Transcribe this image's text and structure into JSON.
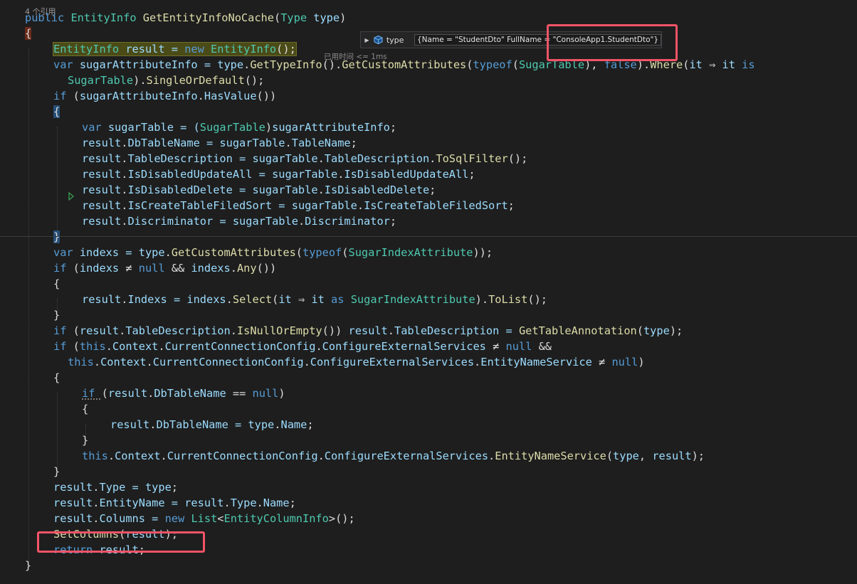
{
  "codelens": "4 个引用",
  "elapsed": "已用时间 <= 1ms",
  "datatip": {
    "expand_icon": "triangle-right-icon",
    "type_icon": "field-icon",
    "name": "type",
    "value": "{Name = \"StudentDto\" FullName = \"ConsoleApp1.StudentDto\"}"
  },
  "colors": {
    "background": "#1e1e1e",
    "keyword": "#569cd6",
    "type": "#4ec9b0",
    "method": "#dcdcaa",
    "variable": "#9cdcfe",
    "text": "#dcdcdc",
    "highlight_box": "#f25467",
    "current_line": "#4b4b18"
  },
  "code_lines": [
    [
      [
        "public ",
        "kw"
      ],
      [
        "EntityInfo ",
        "ty"
      ],
      [
        "GetEntityInfoNoCache",
        "fn"
      ],
      [
        "(",
        "pl"
      ],
      [
        "Type ",
        "ty"
      ],
      [
        "type",
        "vr"
      ],
      [
        ")",
        "pl"
      ]
    ],
    [
      [
        "{",
        "pl"
      ]
    ],
    [
      [
        "EntityInfo ",
        "ty"
      ],
      [
        "result = ",
        "vr"
      ],
      [
        "new ",
        "kw"
      ],
      [
        "EntityInfo",
        "ty"
      ],
      [
        "();",
        "pl"
      ]
    ],
    [
      [
        "var ",
        "kw"
      ],
      [
        "sugarAttributeInfo = ",
        "vr"
      ],
      [
        "type",
        "vr"
      ],
      [
        ".",
        "pl"
      ],
      [
        "GetTypeInfo",
        "fn"
      ],
      [
        "().",
        "pl"
      ],
      [
        "GetCustomAttributes",
        "fn"
      ],
      [
        "(",
        "pl"
      ],
      [
        "typeof",
        "kw"
      ],
      [
        "(",
        "pl"
      ],
      [
        "SugarTable",
        "ty"
      ],
      [
        "), ",
        "pl"
      ],
      [
        "false",
        "kw"
      ],
      [
        ").",
        "pl"
      ],
      [
        "Where",
        "fn"
      ],
      [
        "(",
        "pl"
      ],
      [
        "it ",
        "vr"
      ],
      [
        "⇒ ",
        "pl"
      ],
      [
        "it ",
        "vr"
      ],
      [
        "is",
        "kw"
      ]
    ],
    [
      [
        "SugarTable",
        "ty"
      ],
      [
        ").",
        "pl"
      ],
      [
        "SingleOrDefault",
        "fn"
      ],
      [
        "();",
        "pl"
      ]
    ],
    [
      [
        "if ",
        "kw"
      ],
      [
        "(",
        "pl"
      ],
      [
        "sugarAttributeInfo",
        "vr"
      ],
      [
        ".",
        "pl"
      ],
      [
        "HasValue",
        "vr"
      ],
      [
        "())",
        "pl"
      ]
    ],
    [
      [
        "{",
        "pl"
      ]
    ],
    [
      [
        "var ",
        "kw"
      ],
      [
        "sugarTable = (",
        "vr"
      ],
      [
        "SugarTable",
        "ty"
      ],
      [
        ")",
        "pl"
      ],
      [
        "sugarAttributeInfo",
        "vr"
      ],
      [
        ";",
        "pl"
      ]
    ],
    [
      [
        "result",
        "vr"
      ],
      [
        ".",
        "pl"
      ],
      [
        "DbTableName = ",
        "vr"
      ],
      [
        "sugarTable",
        "vr"
      ],
      [
        ".",
        "pl"
      ],
      [
        "TableName",
        "vr"
      ],
      [
        ";",
        "pl"
      ]
    ],
    [
      [
        "result",
        "vr"
      ],
      [
        ".",
        "pl"
      ],
      [
        "TableDescription = ",
        "vr"
      ],
      [
        "sugarTable",
        "vr"
      ],
      [
        ".",
        "pl"
      ],
      [
        "TableDescription",
        "vr"
      ],
      [
        ".",
        "pl"
      ],
      [
        "ToSqlFilter",
        "fn"
      ],
      [
        "();",
        "pl"
      ]
    ],
    [
      [
        "result",
        "vr"
      ],
      [
        ".",
        "pl"
      ],
      [
        "IsDisabledUpdateAll = ",
        "vr"
      ],
      [
        "sugarTable",
        "vr"
      ],
      [
        ".",
        "pl"
      ],
      [
        "IsDisabledUpdateAll",
        "vr"
      ],
      [
        ";",
        "pl"
      ]
    ],
    [
      [
        "result",
        "vr"
      ],
      [
        ".",
        "pl"
      ],
      [
        "IsDisabledDelete = ",
        "vr"
      ],
      [
        "sugarTable",
        "vr"
      ],
      [
        ".",
        "pl"
      ],
      [
        "IsDisabledDelete",
        "vr"
      ],
      [
        ";",
        "pl"
      ]
    ],
    [
      [
        "result",
        "vr"
      ],
      [
        ".",
        "pl"
      ],
      [
        "IsCreateTableFiledSort = ",
        "vr"
      ],
      [
        "sugarTable",
        "vr"
      ],
      [
        ".",
        "pl"
      ],
      [
        "IsCreateTableFiledSort",
        "vr"
      ],
      [
        ";",
        "pl"
      ]
    ],
    [
      [
        "result",
        "vr"
      ],
      [
        ".",
        "pl"
      ],
      [
        "Discriminator = ",
        "vr"
      ],
      [
        "sugarTable",
        "vr"
      ],
      [
        ".",
        "pl"
      ],
      [
        "Discriminator",
        "vr"
      ],
      [
        ";",
        "pl"
      ]
    ],
    [
      [
        "}",
        "pl"
      ]
    ],
    [
      [
        "var ",
        "kw"
      ],
      [
        "indexs = ",
        "vr"
      ],
      [
        "type",
        "vr"
      ],
      [
        ".",
        "pl"
      ],
      [
        "GetCustomAttributes",
        "fn"
      ],
      [
        "(",
        "pl"
      ],
      [
        "typeof",
        "kw"
      ],
      [
        "(",
        "pl"
      ],
      [
        "SugarIndexAttribute",
        "ty"
      ],
      [
        "));",
        "pl"
      ]
    ],
    [
      [
        "if ",
        "kw"
      ],
      [
        "(",
        "pl"
      ],
      [
        "indexs ",
        "vr"
      ],
      [
        "≠ ",
        "pl"
      ],
      [
        "null ",
        "kw"
      ],
      [
        "&& ",
        "pl"
      ],
      [
        "indexs",
        "vr"
      ],
      [
        ".",
        "pl"
      ],
      [
        "Any",
        "fn"
      ],
      [
        "())",
        "pl"
      ]
    ],
    [
      [
        "{",
        "pl"
      ]
    ],
    [
      [
        "result",
        "vr"
      ],
      [
        ".",
        "pl"
      ],
      [
        "Indexs = ",
        "vr"
      ],
      [
        "indexs",
        "vr"
      ],
      [
        ".",
        "pl"
      ],
      [
        "Select",
        "fn"
      ],
      [
        "(",
        "pl"
      ],
      [
        "it ",
        "vr"
      ],
      [
        "⇒ ",
        "pl"
      ],
      [
        "it ",
        "vr"
      ],
      [
        "as ",
        "kw"
      ],
      [
        "SugarIndexAttribute",
        "ty"
      ],
      [
        ").",
        "pl"
      ],
      [
        "ToList",
        "fn"
      ],
      [
        "();",
        "pl"
      ]
    ],
    [
      [
        "}",
        "pl"
      ]
    ],
    [
      [
        "if ",
        "kw"
      ],
      [
        "(",
        "pl"
      ],
      [
        "result",
        "vr"
      ],
      [
        ".",
        "pl"
      ],
      [
        "TableDescription",
        "vr"
      ],
      [
        ".",
        "pl"
      ],
      [
        "IsNullOrEmpty",
        "fn"
      ],
      [
        "()) ",
        "pl"
      ],
      [
        "result",
        "vr"
      ],
      [
        ".",
        "pl"
      ],
      [
        "TableDescription = ",
        "vr"
      ],
      [
        "GetTableAnnotation",
        "fn"
      ],
      [
        "(",
        "pl"
      ],
      [
        "type",
        "vr"
      ],
      [
        ");",
        "pl"
      ]
    ],
    [
      [
        "if ",
        "kw"
      ],
      [
        "(",
        "pl"
      ],
      [
        "this",
        "kw"
      ],
      [
        ".",
        "pl"
      ],
      [
        "Context",
        "vr"
      ],
      [
        ".",
        "pl"
      ],
      [
        "CurrentConnectionConfig",
        "vr"
      ],
      [
        ".",
        "pl"
      ],
      [
        "ConfigureExternalServices ",
        "vr"
      ],
      [
        "≠ ",
        "pl"
      ],
      [
        "null ",
        "kw"
      ],
      [
        "&&",
        "pl"
      ]
    ],
    [
      [
        "this",
        "kw"
      ],
      [
        ".",
        "pl"
      ],
      [
        "Context",
        "vr"
      ],
      [
        ".",
        "pl"
      ],
      [
        "CurrentConnectionConfig",
        "vr"
      ],
      [
        ".",
        "pl"
      ],
      [
        "ConfigureExternalServices",
        "vr"
      ],
      [
        ".",
        "pl"
      ],
      [
        "EntityNameService ",
        "vr"
      ],
      [
        "≠ ",
        "pl"
      ],
      [
        "null",
        "kw"
      ],
      [
        ")",
        "pl"
      ]
    ],
    [
      [
        "{",
        "pl"
      ]
    ],
    [
      [
        "if ",
        "kw"
      ],
      [
        "(",
        "pl"
      ],
      [
        "result",
        "vr"
      ],
      [
        ".",
        "pl"
      ],
      [
        "DbTableName ",
        "vr"
      ],
      [
        "== ",
        "pl"
      ],
      [
        "null",
        "kw"
      ],
      [
        ")",
        "pl"
      ]
    ],
    [
      [
        "{",
        "pl"
      ]
    ],
    [
      [
        "result",
        "vr"
      ],
      [
        ".",
        "pl"
      ],
      [
        "DbTableName = ",
        "vr"
      ],
      [
        "type",
        "vr"
      ],
      [
        ".",
        "pl"
      ],
      [
        "Name",
        "vr"
      ],
      [
        ";",
        "pl"
      ]
    ],
    [
      [
        "}",
        "pl"
      ]
    ],
    [
      [
        "this",
        "kw"
      ],
      [
        ".",
        "pl"
      ],
      [
        "Context",
        "vr"
      ],
      [
        ".",
        "pl"
      ],
      [
        "CurrentConnectionConfig",
        "vr"
      ],
      [
        ".",
        "pl"
      ],
      [
        "ConfigureExternalServices",
        "vr"
      ],
      [
        ".",
        "pl"
      ],
      [
        "EntityNameService",
        "fn"
      ],
      [
        "(",
        "pl"
      ],
      [
        "type",
        "vr"
      ],
      [
        ", ",
        "pl"
      ],
      [
        "result",
        "vr"
      ],
      [
        ");",
        "pl"
      ]
    ],
    [
      [
        "}",
        "pl"
      ]
    ],
    [
      [
        "result",
        "vr"
      ],
      [
        ".",
        "pl"
      ],
      [
        "Type = ",
        "vr"
      ],
      [
        "type",
        "vr"
      ],
      [
        ";",
        "pl"
      ]
    ],
    [
      [
        "result",
        "vr"
      ],
      [
        ".",
        "pl"
      ],
      [
        "EntityName = ",
        "vr"
      ],
      [
        "result",
        "vr"
      ],
      [
        ".",
        "pl"
      ],
      [
        "Type",
        "vr"
      ],
      [
        ".",
        "pl"
      ],
      [
        "Name",
        "vr"
      ],
      [
        ";",
        "pl"
      ]
    ],
    [
      [
        "result",
        "vr"
      ],
      [
        ".",
        "pl"
      ],
      [
        "Columns = ",
        "vr"
      ],
      [
        "new ",
        "kw"
      ],
      [
        "List",
        "ty"
      ],
      [
        "<",
        "pl"
      ],
      [
        "EntityColumnInfo",
        "ty"
      ],
      [
        ">();",
        "pl"
      ]
    ],
    [
      [
        "SetColumns",
        "fn"
      ],
      [
        "(",
        "pl"
      ],
      [
        "result",
        "vr"
      ],
      [
        ");",
        "pl"
      ]
    ],
    [
      [
        "return ",
        "kw"
      ],
      [
        "result",
        "vr"
      ],
      [
        ";",
        "pl"
      ]
    ],
    [
      [
        "}",
        "pl"
      ]
    ]
  ]
}
